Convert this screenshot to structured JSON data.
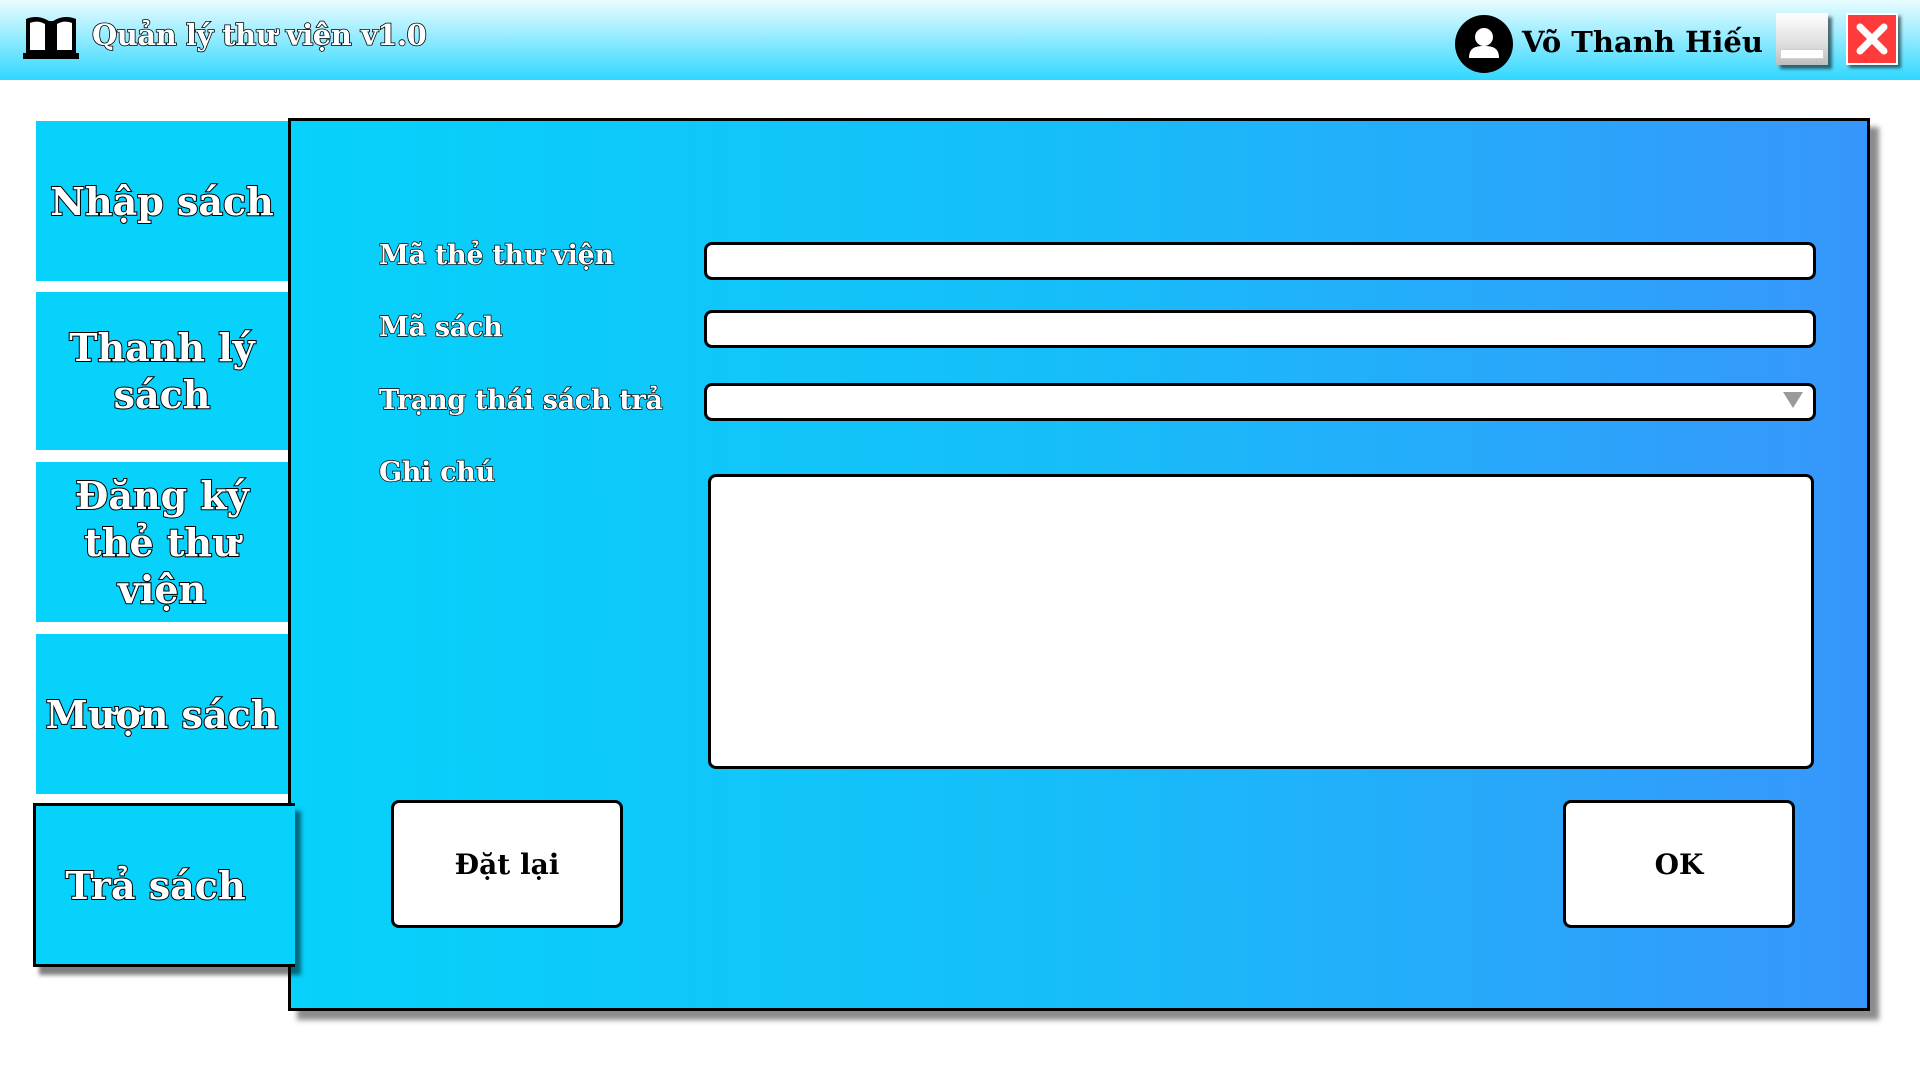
{
  "window": {
    "title": "Quản lý thư viện v1.0",
    "user_name": "Võ Thanh Hiếu"
  },
  "sidebar": {
    "items": [
      {
        "label_lines": [
          "Nhập sách"
        ]
      },
      {
        "label_lines": [
          "Thanh lý",
          "sách"
        ]
      },
      {
        "label_lines": [
          "Đăng ký",
          "thẻ thư viện"
        ]
      },
      {
        "label_lines": [
          "Mượn sách"
        ]
      },
      {
        "label_lines": [
          "Trả sách"
        ],
        "active": true
      }
    ]
  },
  "form": {
    "library_card_label": "Mã thẻ thư viện",
    "library_card_value": "",
    "book_id_label": "Mã sách",
    "book_id_value": "",
    "return_status_label": "Trạng thái sách trả",
    "return_status_value": "",
    "note_label": "Ghi chú",
    "note_value": "",
    "reset_label": "Đặt lại",
    "ok_label": "OK"
  },
  "icons": {
    "app": "book-icon",
    "user": "user-avatar-icon",
    "minimize": "minimize-icon",
    "close": "close-icon",
    "dropdown": "chevron-down-icon"
  },
  "colors": {
    "tab": "#06d2fb",
    "panel_start": "#06d2fb",
    "panel_end": "#3796fb",
    "close": "#ff3a3a"
  }
}
